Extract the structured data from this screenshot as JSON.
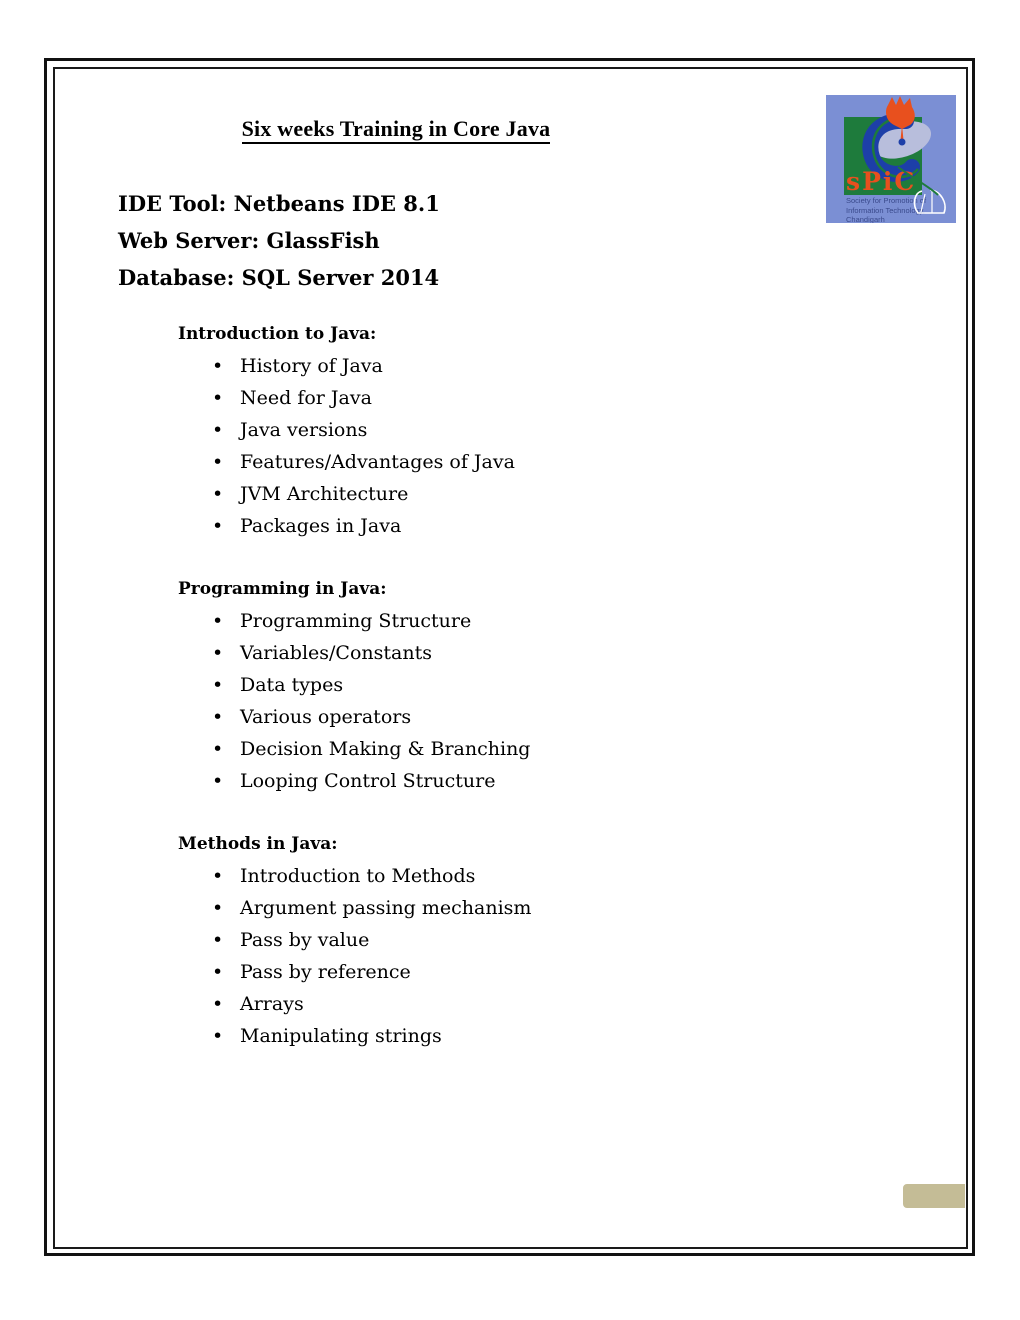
{
  "document": {
    "title": "Six weeks Training in Core Java",
    "header_lines": [
      "IDE Tool: Netbeans IDE 8.1",
      "Web Server: GlassFish",
      "Database: SQL Server 2014"
    ],
    "sections": [
      {
        "heading": "Introduction to Java:",
        "items": [
          "History of Java",
          "Need for Java",
          "Java versions",
          "Features/Advantages of Java",
          "JVM Architecture",
          "Packages in Java"
        ]
      },
      {
        "heading": "Programming in Java:",
        "items": [
          "Programming Structure",
          "Variables/Constants",
          "Data types",
          "Various operators",
          "Decision Making & Branching",
          "Looping Control Structure"
        ]
      },
      {
        "heading": "Methods in Java:",
        "items": [
          "Introduction to Methods",
          "Argument passing mechanism",
          "Pass by value",
          "Pass by reference",
          "Arrays",
          "Manipulating strings"
        ]
      }
    ]
  },
  "logo": {
    "name": "spic-logo",
    "wordmark": "sPiC",
    "tagline_line1": "Society for Promotion of",
    "tagline_line2": "Information Technology,",
    "tagline_line3": "Chandigarh",
    "colors": {
      "background": "#7B8FD4",
      "square": "#1E7B3C",
      "swoosh": "#1D3FA8",
      "bird": "#E8501E",
      "disc": "#B8BEDC",
      "wordmark": "#E8501E",
      "tagline": "#3A4A8C"
    }
  },
  "bullet_glyph": "•",
  "shapes": {
    "tan_box": {
      "name": "tan-rounded-rectangle",
      "fill": "#C4BC96",
      "outline": "#FFFFFF"
    }
  },
  "page": {
    "background": "#FFFFFF",
    "border_color": "#111111"
  }
}
